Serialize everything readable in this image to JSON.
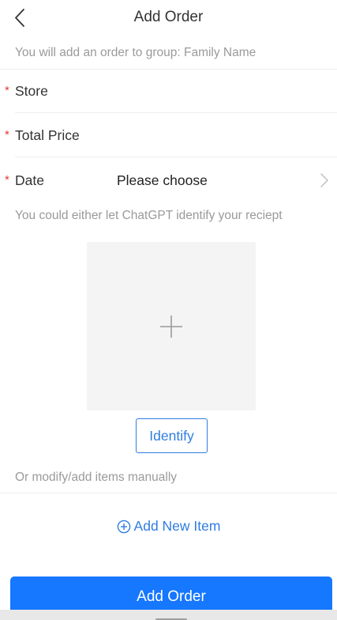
{
  "navbar": {
    "title": "Add Order",
    "back_icon": "chevron-left-icon"
  },
  "group_hint": "You will add an order to group: Family Name",
  "form": {
    "required_mark": "*",
    "store": {
      "label": "Store",
      "value": "",
      "placeholder": ""
    },
    "total_price": {
      "label": "Total Price",
      "value": "",
      "placeholder": ""
    },
    "date": {
      "label": "Date",
      "value": "Please choose",
      "icon": "chevron-right-icon"
    }
  },
  "gpt_hint": "You could either let ChatGPT identify your reciept",
  "upload": {
    "icon": "plus-icon"
  },
  "identify_label": "Identify",
  "manual_hint": "Or modify/add items manually",
  "add_item": {
    "label": "Add New Item",
    "icon": "plus-circle-icon"
  },
  "submit_label": "Add Order",
  "colors": {
    "primary": "#1677ff",
    "link": "#2f7de1",
    "required": "#e53935",
    "hint_text": "#9a9a9a",
    "upload_bg": "#f4f4f4"
  }
}
